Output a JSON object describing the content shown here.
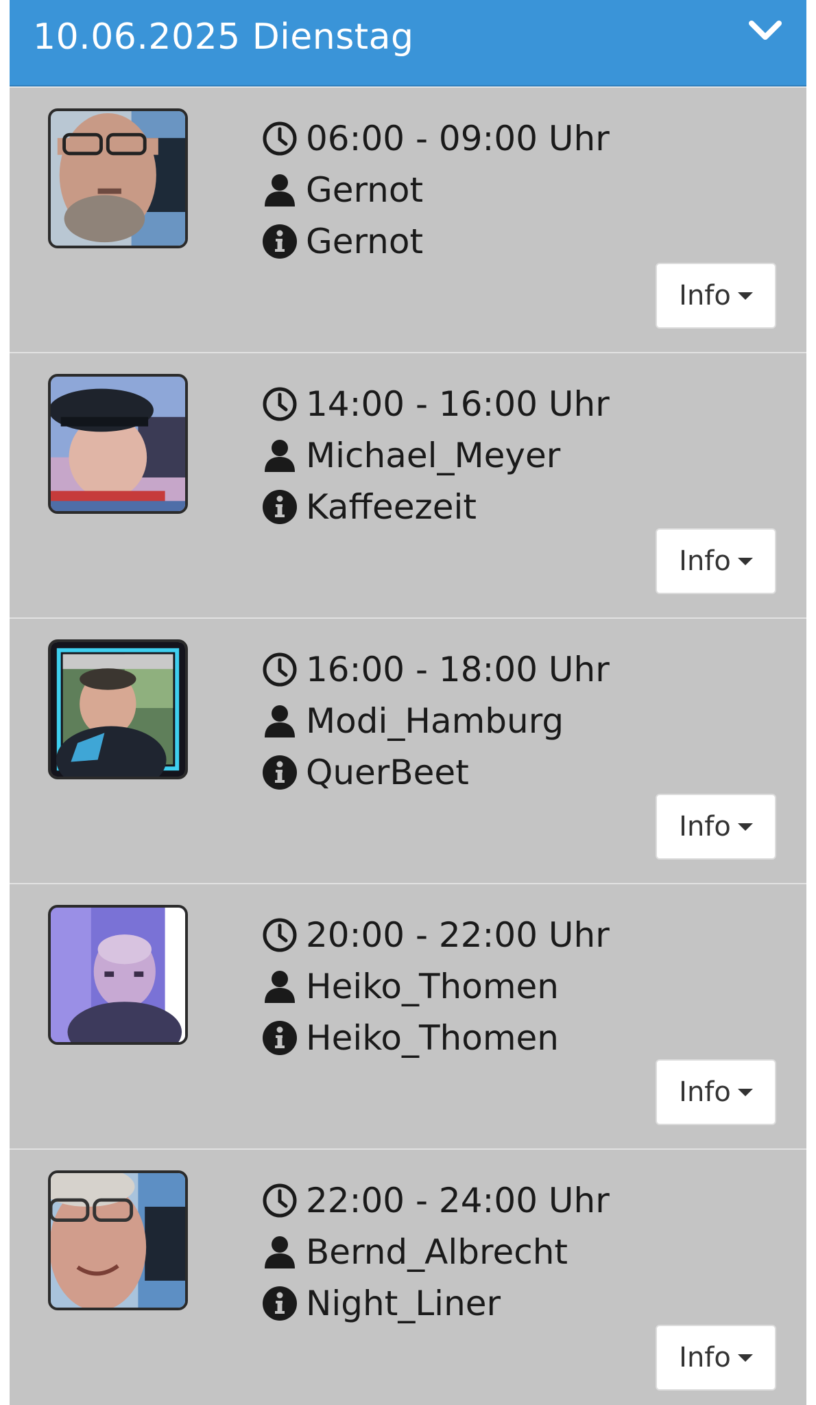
{
  "header": {
    "title": "10.06.2025 Dienstag",
    "toggle_icon": "chevron-down-icon",
    "background_color": "#3a94d8"
  },
  "slots": [
    {
      "time": "06:00 - 09:00 Uhr",
      "host": "Gernot",
      "show": "Gernot",
      "button": "Info"
    },
    {
      "time": "14:00 - 16:00 Uhr",
      "host": "Michael_Meyer",
      "show": "Kaffeezeit",
      "button": "Info"
    },
    {
      "time": "16:00 - 18:00 Uhr",
      "host": "Modi_Hamburg",
      "show": "QuerBeet",
      "button": "Info"
    },
    {
      "time": "20:00 - 22:00 Uhr",
      "host": "Heiko_Thomen",
      "show": "Heiko_Thomen",
      "button": "Info"
    },
    {
      "time": "22:00 - 24:00 Uhr",
      "host": "Bernd_Albrecht",
      "show": "Night_Liner",
      "button": "Info"
    }
  ],
  "icons": {
    "time": "clock-icon",
    "host": "user-icon",
    "show": "info-circle-icon",
    "button_caret": "caret-down-icon"
  }
}
